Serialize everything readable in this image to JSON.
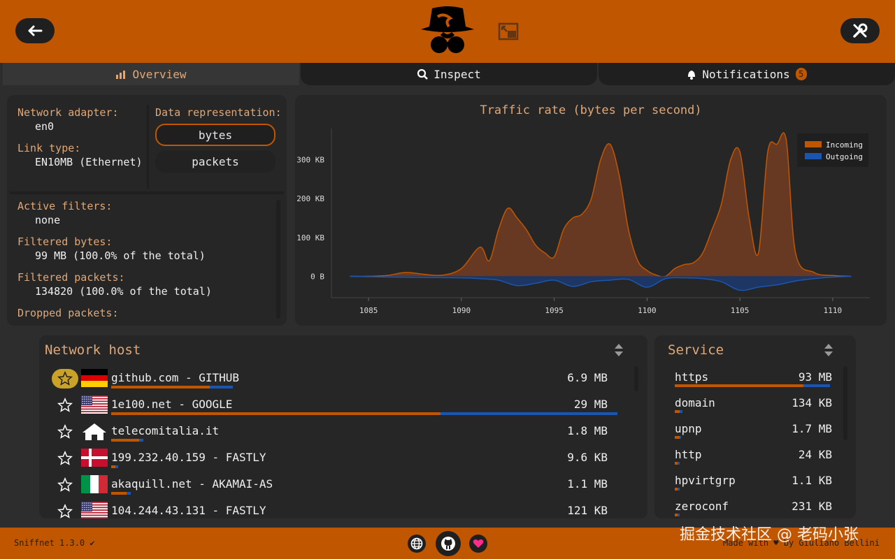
{
  "header": {
    "back_icon": "arrow-left-icon",
    "settings_icon": "wrench-screwdriver-icon",
    "logo_icon": "spy-hat-logo-icon",
    "pip_icon": "picture-in-picture-icon"
  },
  "tabs": [
    {
      "label": "Overview",
      "icon": "chart-icon"
    },
    {
      "label": "Inspect",
      "icon": "magnifier-icon"
    },
    {
      "label": "Notifications",
      "icon": "bell-icon",
      "badge": "5"
    }
  ],
  "info": {
    "adapter_label": "Network adapter:",
    "adapter_value": "en0",
    "link_label": "Link type:",
    "link_value": "EN10MB (Ethernet)",
    "repr_label": "Data representation:",
    "repr_options": [
      "bytes",
      "packets"
    ],
    "filters_label": "Active filters:",
    "filters_value": "none",
    "fbytes_label": "Filtered bytes:",
    "fbytes_value": "99 MB (100.0% of the total)",
    "fpackets_label": "Filtered packets:",
    "fpackets_value": "134820 (100.0% of the total)",
    "dropped_label": "Dropped packets:"
  },
  "chart_data": {
    "type": "area",
    "title": "Traffic rate (bytes per second)",
    "xlabel": "",
    "ylabel": "",
    "xlim": [
      1083,
      1112
    ],
    "ylim": [
      -55,
      380
    ],
    "x_ticks": [
      1085,
      1090,
      1095,
      1100,
      1105,
      1110
    ],
    "y_ticks": [
      0,
      100,
      200,
      300
    ],
    "y_tick_labels": [
      "0 B",
      "100 KB",
      "200 KB",
      "300 KB"
    ],
    "legend": "top-right",
    "series": [
      {
        "name": "Incoming",
        "color": "#c05600",
        "x": [
          1084,
          1085,
          1086,
          1087,
          1088,
          1089,
          1090,
          1091,
          1091.5,
          1092,
          1092.5,
          1093,
          1093.5,
          1094,
          1094.5,
          1095,
          1095.5,
          1096,
          1096.5,
          1097,
          1097.5,
          1098,
          1098.5,
          1099,
          1099.5,
          1100,
          1100.5,
          1101,
          1101.5,
          1102,
          1102.5,
          1103,
          1103.5,
          1104,
          1104.5,
          1105,
          1105.5,
          1106,
          1106.5,
          1107,
          1107.5,
          1108,
          1109,
          1110,
          1111
        ],
        "values": [
          0,
          0,
          2,
          10,
          5,
          3,
          20,
          75,
          40,
          120,
          175,
          150,
          120,
          80,
          60,
          50,
          120,
          150,
          160,
          200,
          300,
          340,
          260,
          120,
          40,
          15,
          3,
          0,
          20,
          30,
          35,
          60,
          120,
          185,
          300,
          320,
          150,
          60,
          320,
          340,
          350,
          60,
          10,
          2,
          0
        ]
      },
      {
        "name": "Outgoing",
        "color": "#1a56b0",
        "x": [
          1084,
          1086,
          1088,
          1090,
          1091,
          1092,
          1093,
          1094,
          1095,
          1096,
          1097,
          1098,
          1099,
          1100,
          1101,
          1102,
          1103,
          1104,
          1105,
          1106,
          1107,
          1108,
          1109,
          1110,
          1111
        ],
        "values": [
          0,
          -2,
          -3,
          -4,
          -6,
          -10,
          -24,
          -18,
          -10,
          -26,
          -14,
          -10,
          -8,
          -28,
          -6,
          -4,
          -6,
          -14,
          -36,
          -28,
          -22,
          -12,
          -6,
          -2,
          0
        ]
      }
    ]
  },
  "hosts": {
    "title": "Network host",
    "sort_icon": "sort-arrows-icon",
    "rows": [
      {
        "name": "github.com - GITHUB",
        "size": "6.9 MB",
        "flag": "de",
        "starred": true,
        "bar_in": 0.195,
        "bar_out": 0.045
      },
      {
        "name": "1e100.net - GOOGLE",
        "size": "29 MB",
        "flag": "us",
        "starred": false,
        "bar_in": 0.65,
        "bar_out": 0.35
      },
      {
        "name": "telecomitalia.it",
        "size": "1.8 MB",
        "flag": "home",
        "starred": false,
        "bar_in": 0.055,
        "bar_out": 0.008
      },
      {
        "name": "199.232.40.159 - FASTLY",
        "size": "9.6 KB",
        "flag": "dk",
        "starred": false,
        "bar_in": 0.008,
        "bar_out": 0.006
      },
      {
        "name": "akaquill.net - AKAMAI-AS",
        "size": "1.1 MB",
        "flag": "it",
        "starred": false,
        "bar_in": 0.03,
        "bar_out": 0.008
      },
      {
        "name": "104.244.43.131 - FASTLY",
        "size": "121 KB",
        "flag": "us",
        "starred": false,
        "bar_in": 0.01,
        "bar_out": 0.005
      }
    ]
  },
  "services": {
    "title": "Service",
    "sort_icon": "sort-arrows-icon",
    "rows": [
      {
        "name": "https",
        "size": "93 MB",
        "bar_in": 0.83,
        "bar_out": 0.17
      },
      {
        "name": "domain",
        "size": "134 KB",
        "bar_in": 0.03,
        "bar_out": 0.02
      },
      {
        "name": "upnp",
        "size": "1.7 MB",
        "bar_in": 0.03,
        "bar_out": 0.01
      },
      {
        "name": "http",
        "size": "24 KB",
        "bar_in": 0.02,
        "bar_out": 0.01
      },
      {
        "name": "hpvirtgrp",
        "size": "1.1 KB",
        "bar_in": 0.02,
        "bar_out": 0.01
      },
      {
        "name": "zeroconf",
        "size": "231 KB",
        "bar_in": 0.02,
        "bar_out": 0.01
      }
    ]
  },
  "footer": {
    "version": "Sniffnet 1.3.0 ✔",
    "made_with": "Made with ♥ by Giuliano Bellini",
    "icons": [
      "globe-icon",
      "github-icon",
      "heart-icon"
    ]
  },
  "watermark": "掘金技术社区 @ 老码小张"
}
